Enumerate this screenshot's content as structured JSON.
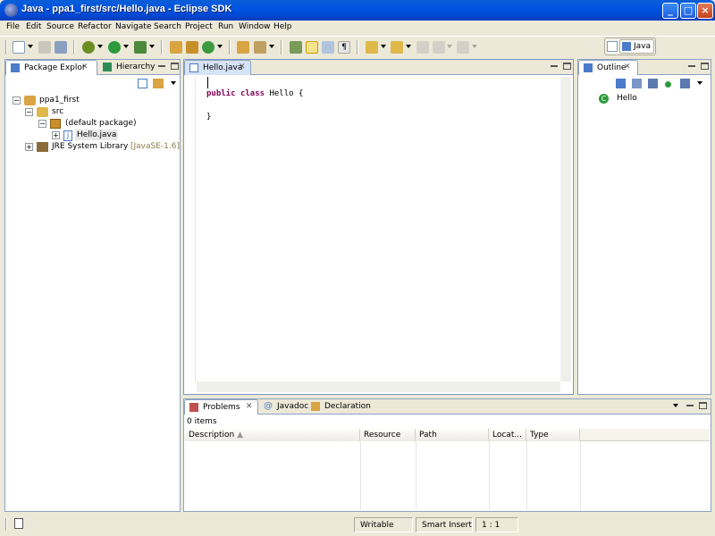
{
  "window": {
    "title": "Java - ppa1_first/src/Hello.java - Eclipse SDK"
  },
  "menu": [
    "File",
    "Edit",
    "Source",
    "Refactor",
    "Navigate",
    "Search",
    "Project",
    "Run",
    "Window",
    "Help"
  ],
  "perspective": {
    "label": "Java"
  },
  "package_explorer": {
    "tabs": [
      "Package Explor",
      "Hierarchy"
    ],
    "tree": [
      {
        "label": "ppa1_first",
        "suffix": "",
        "level": 0,
        "toggle": "−",
        "icon": "project-icon"
      },
      {
        "label": "src",
        "suffix": "",
        "level": 1,
        "toggle": "−",
        "icon": "source-folder-icon"
      },
      {
        "label": "(default package)",
        "suffix": "",
        "level": 2,
        "toggle": "−",
        "icon": "package-icon"
      },
      {
        "label": "Hello.java",
        "suffix": "",
        "level": 3,
        "toggle": "+",
        "icon": "java-file-icon"
      },
      {
        "label": "JRE System Library",
        "suffix": "[JavaSE-1.6]",
        "level": 1,
        "toggle": "+",
        "icon": "library-icon"
      }
    ]
  },
  "editor": {
    "tab": "Hello.java",
    "code": {
      "line1_kw1": "public",
      "line1_kw2": "class",
      "line1_rest": " Hello {",
      "line3": "}"
    }
  },
  "outline": {
    "tab": "Outline",
    "item": "Hello"
  },
  "bottom_panel": {
    "tabs": [
      "Problems",
      "Javadoc",
      "Declaration"
    ],
    "summary": "0 items",
    "columns": [
      "Description",
      "Resource",
      "Path",
      "Locat...",
      "Type"
    ]
  },
  "status": {
    "writable": "Writable",
    "insert_mode": "Smart Insert",
    "position": "1 : 1"
  },
  "colors": {
    "titlebar": "#0054e3",
    "keyword": "#7f0055",
    "chrome": "#ece9d8",
    "panel_border": "#8da2c1"
  }
}
